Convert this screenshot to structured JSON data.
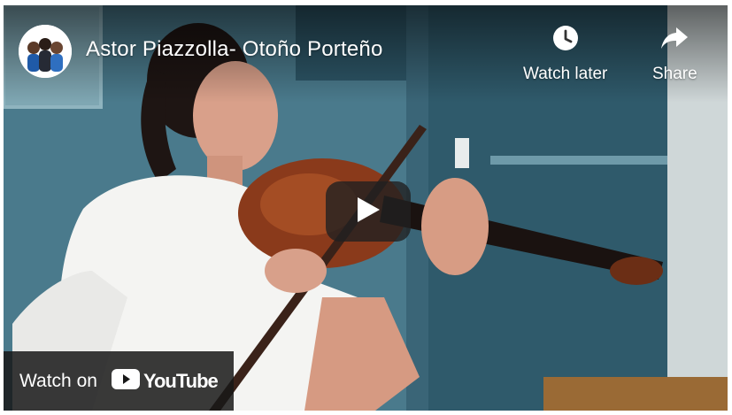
{
  "video": {
    "title": "Astor Piazzolla- Otoño Porteño",
    "accent_color": "#ff0000"
  },
  "actions": {
    "watch_later_label": "Watch later",
    "watch_later_icon": "clock-icon",
    "share_label": "Share",
    "share_icon": "share-arrow-icon"
  },
  "player": {
    "play_icon": "play-icon"
  },
  "footer": {
    "watch_on_label": "Watch on",
    "brand_label": "YouTube"
  }
}
